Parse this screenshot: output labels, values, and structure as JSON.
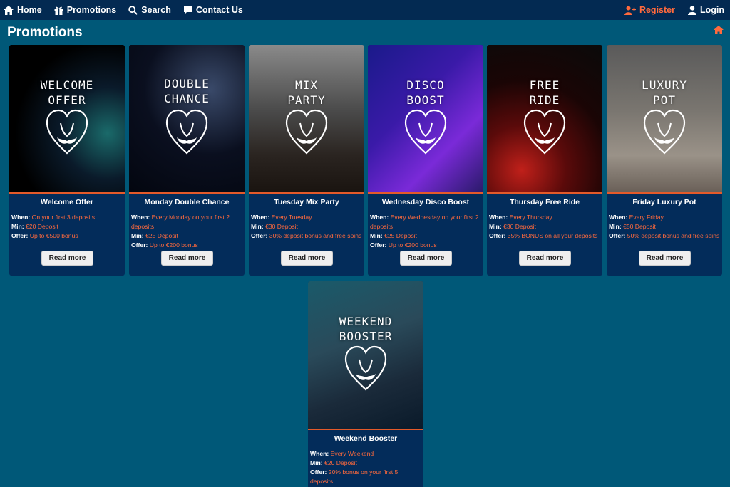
{
  "nav": {
    "home": "Home",
    "promotions": "Promotions",
    "search": "Search",
    "contact": "Contact Us",
    "register": "Register",
    "login": "Login"
  },
  "page": {
    "title": "Promotions"
  },
  "labels": {
    "when": "When:",
    "min": "Min:",
    "offer": "Offer:",
    "read_more": "Read more"
  },
  "cards": [
    {
      "image_text": "Welcome Offer",
      "title": "Welcome Offer",
      "when": "On your first 3 deposits",
      "min": "€20 Deposit",
      "offer": "Up to €500 bonus"
    },
    {
      "image_text": "Double Chance",
      "title": "Monday Double Chance",
      "when": "Every Monday on your first 2 deposits",
      "min": "€25 Deposit",
      "offer": "Up to €200 bonus"
    },
    {
      "image_text": "Mix Party",
      "title": "Tuesday Mix Party",
      "when": "Every Tuesday",
      "min": "€30 Deposit",
      "offer": "30% deposit bonus and free spins"
    },
    {
      "image_text": "Disco Boost",
      "title": "Wednesday Disco Boost",
      "when": "Every Wednesday on your first 2 deposits",
      "min": "€25 Deposit",
      "offer": "Up to €200 bonus"
    },
    {
      "image_text": "Free Ride",
      "title": "Thursday Free Ride",
      "when": "Every Thursday",
      "min": "€30 Deposit",
      "offer": "35% BONUS on all your deposits"
    },
    {
      "image_text": "Luxury Pot",
      "title": "Friday Luxury Pot",
      "when": "Every Friday",
      "min": "€50 Deposit",
      "offer": "50% deposit bonus and free spins"
    },
    {
      "image_text": "Weekend Booster",
      "title": "Weekend Booster",
      "when": "Every Weekend",
      "min": "€20 Deposit",
      "offer": "20% bonus on your first 5 deposits"
    }
  ],
  "colors": {
    "nav_bg": "#032a52",
    "page_bg": "#005878",
    "card_bg": "#032c5a",
    "accent": "#ff6a3d"
  }
}
